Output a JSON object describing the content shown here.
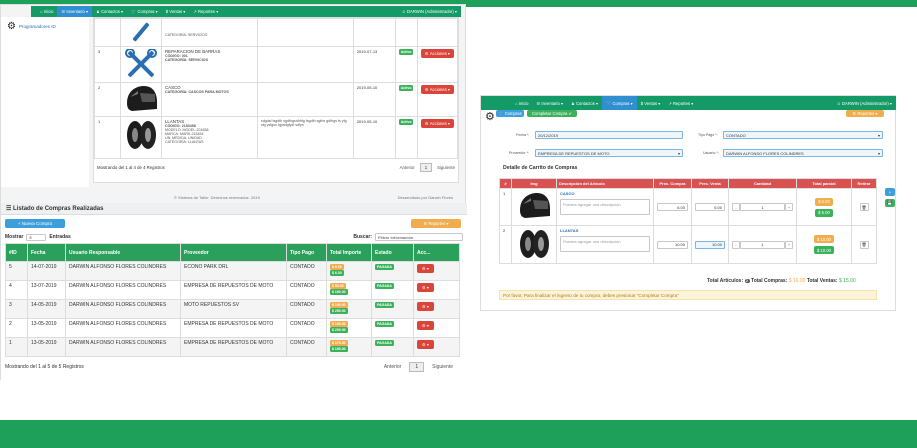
{
  "nav_left": {
    "items": [
      "Inicio",
      "Inventario",
      "Contactos",
      "Compras",
      "Ventas",
      "Reportes"
    ],
    "user": "DARWIN (Administrador)"
  },
  "left_sidebar": {
    "item": "Programadores ID"
  },
  "products": {
    "rows": [
      {
        "num": "3",
        "name": "REPARACION DE BARRAS",
        "code": "CÓDIGO: 001",
        "category": "CATEGORÍA: SERVICIOS",
        "date": "2019-07-13",
        "status": "Activo",
        "action": "Acciones",
        "icon": "tools-icon"
      },
      {
        "num": "2",
        "name": "CASCO",
        "category": "CATEGORÍA: CASCOS PARA MOTOS",
        "date": "2019-05-10",
        "status": "Activo",
        "action": "Acciones",
        "icon": "helmet-icon"
      },
      {
        "num": "1",
        "name": "LLANTAS",
        "code": "CÓDIGO: 2153458",
        "model": "MODELO: MODEL-201658",
        "brand": "MARCA: MARK-215454",
        "unit": "UN. MEDIDA: UNIDAD",
        "category": "CATEGORÍA: LLANTAS",
        "description": "sdgdsf fsgdfh sgdfhgsdhfdg fsgdfh sgfhs gdfhgs fs yfg sfg ysfgsu fgysdgfysf sdfys",
        "date": "2019-05-10",
        "status": "Activo",
        "action": "Acciones",
        "icon": "tire-icon"
      }
    ],
    "showing": "Mostrando del 1 al 4 de 4 Registros",
    "prev": "Anterior",
    "page": "1",
    "next": "Siguiente"
  },
  "footer": {
    "copyright": "© Sistema de Taller. Derechos reservados. 2019",
    "dev": "Desarrollado por Darwin Flores"
  },
  "purchases": {
    "title": "Listado de Compras Realizadas",
    "new_button": "+ Nueva Compra",
    "reports_button": "Reportes",
    "show_label": "Mostrar",
    "show_value": "5",
    "entries_label": "Entradas",
    "search_label": "Buscar:",
    "search_placeholder": "Filtrar información",
    "headers": [
      "#ID",
      "Fecha",
      "Usuario Responsable",
      "Proveedor",
      "Tipo Pago",
      "Total Importe",
      "Estado",
      "Acc..."
    ],
    "rows": [
      {
        "id": "5",
        "date": "14-07-2019",
        "user": "DARWIN ALFONSO FLORES COLINDRES",
        "provider": "ECONO PARK DRL",
        "pay": "CONTADO",
        "t1": "$ 6.00",
        "t2": "$ 6.00",
        "status": "PAGADA"
      },
      {
        "id": "4",
        "date": "13-07-2019",
        "user": "DARWIN ALFONSO FLORES COLINDRES",
        "provider": "EMPRESA DE REPUESTOS DE MOTO",
        "pay": "CONTADO",
        "t1": "$ 80.00",
        "t2": "$ 160.00",
        "status": "PAGADA"
      },
      {
        "id": "3",
        "date": "14-05-2019",
        "user": "DARWIN ALFONSO FLORES COLINDRES",
        "provider": "MOTO REPUESTOS SV",
        "pay": "CONTADO",
        "t1": "$ 190.00",
        "t2": "$ 250.00",
        "status": "PAGADA"
      },
      {
        "id": "2",
        "date": "13-05-2019",
        "user": "DARWIN ALFONSO FLORES COLINDRES",
        "provider": "EMPRESA DE REPUESTOS DE MOTO",
        "pay": "CONTADO",
        "t1": "$ 100.00",
        "t2": "$ 200.00",
        "status": "PAGADA"
      },
      {
        "id": "1",
        "date": "13-05-2019",
        "user": "DARWIN ALFONSO FLORES COLINDRES",
        "provider": "EMPRESA DE REPUESTOS DE MOTO",
        "pay": "CONTADO",
        "t1": "$ 170.00",
        "t2": "$ 165.00",
        "status": "PAGADA"
      }
    ],
    "showing": "Mostrando del 1 al 5 de 5 Registros",
    "prev": "Anterior",
    "page": "1",
    "next": "Siguiente"
  },
  "nav_right": {
    "items": [
      "Inicio",
      "Inventario",
      "Contactos",
      "Compras",
      "Ventas",
      "Reportes"
    ],
    "user": "DARWIN (Administrador)"
  },
  "compra_form": {
    "compras_button": "Compras",
    "complete_top_button": "Completar Compra",
    "reports_button": "Reportes",
    "fecha_label": "Fecha *:",
    "fecha_value": "20/12/2019",
    "tipo_pago_label": "Tipo Pago *:",
    "tipo_pago_value": "CONTADO",
    "proveedor_label": "Proveedor *:",
    "proveedor_value": "EMPRESA DE REPUESTOS DE MOTO",
    "usuario_label": "Usuario *:",
    "usuario_value": "DARWIN ALFONSO FLORES COLINDRES",
    "cart_title": "Detalle de Carrito de Compras",
    "headers": [
      "#",
      "Img",
      "Descripción del Artículo",
      "Prec. Compra",
      "Prec. Venta",
      "Cantidad",
      "Total parcial",
      "Retirar"
    ],
    "rows": [
      {
        "num": "1",
        "name": "CASCO",
        "desc_placeholder": "Puedes agregar una descripción",
        "compra": "6.00",
        "venta": "5.00",
        "qty": "1",
        "total1": "$ 6.00",
        "total2": "$ 5.00",
        "icon": "helmet-icon"
      },
      {
        "num": "2",
        "name": "LLANTAS",
        "desc_placeholder": "Puedes agregar una descripción",
        "compra": "10.00",
        "venta": "10.00",
        "qty": "1",
        "total1": "$ 10.00",
        "total2": "$ 10.00",
        "icon": "tire-icon"
      }
    ],
    "totals": {
      "articulos_label": "Total Artículos:",
      "articulos": "2",
      "compras_label": "Total Compras:",
      "compras": "$ 16.00",
      "ventas_label": "Total Ventas:",
      "ventas": "$ 15.00"
    },
    "warning": "Por favor, Para finalizar el ingreso de tu compra, debes presionar \"Completar Compra\""
  },
  "colors": {
    "green": "#1ea05a",
    "blue": "#3c9fdc",
    "red": "#d9453a",
    "orange": "#f0ad4e"
  }
}
